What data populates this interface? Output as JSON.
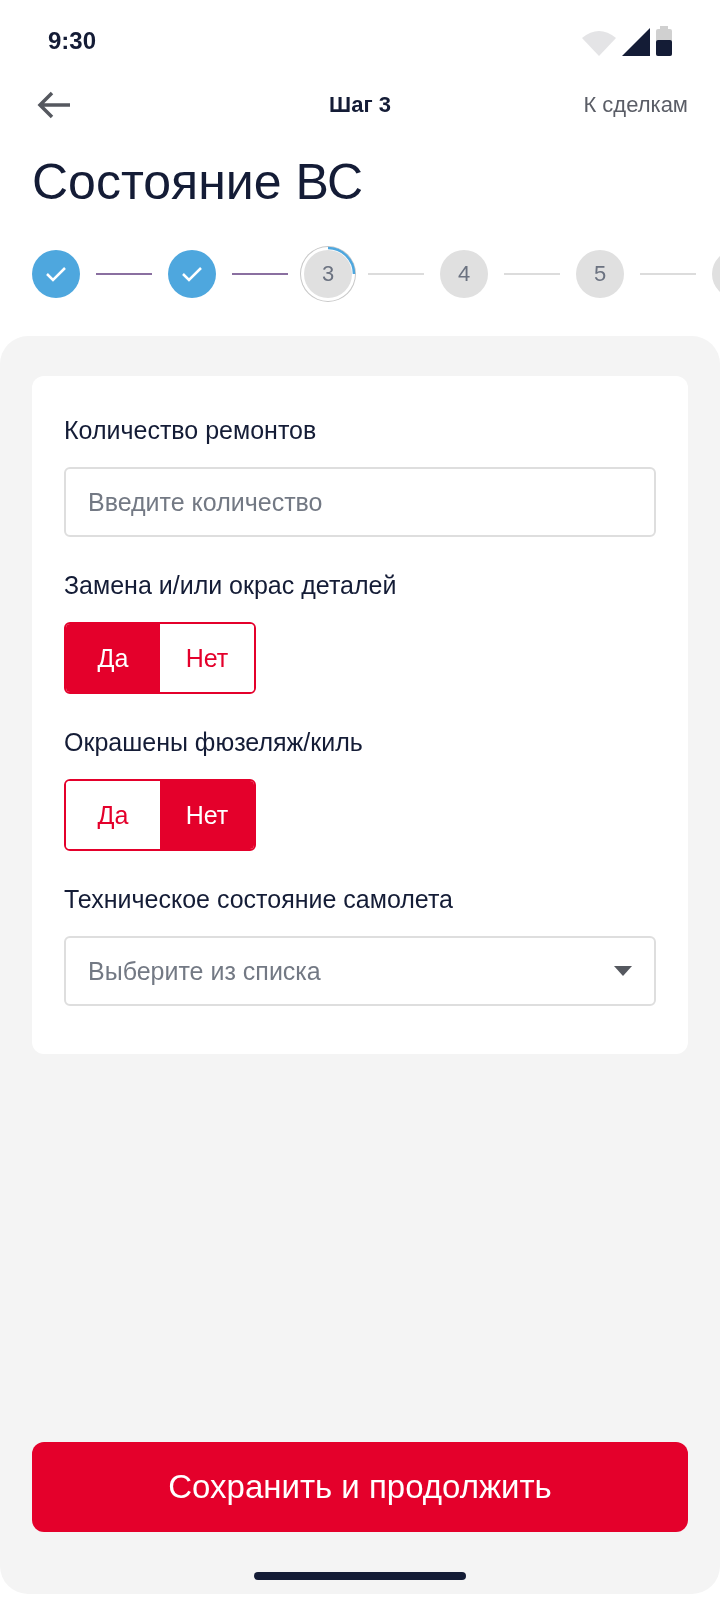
{
  "status_bar": {
    "time": "9:30"
  },
  "header": {
    "title": "Шаг 3",
    "action": "К сделкам"
  },
  "page_title": "Состояние ВС",
  "steps": [
    {
      "kind": "done"
    },
    {
      "kind": "done"
    },
    {
      "kind": "current",
      "label": "3"
    },
    {
      "kind": "upcoming",
      "label": "4"
    },
    {
      "kind": "upcoming",
      "label": "5"
    },
    {
      "kind": "upcoming"
    }
  ],
  "fields": [
    {
      "kind": "input",
      "label": "Количество ремонтов",
      "placeholder": "Введите количество"
    },
    {
      "kind": "toggle",
      "label": "Замена и/или окрас деталей",
      "options": [
        {
          "label": "Да",
          "selected": true
        },
        {
          "label": "Нет",
          "selected": false
        }
      ]
    },
    {
      "kind": "toggle",
      "label": "Окрашены фюзеляж/киль",
      "options": [
        {
          "label": "Да",
          "selected": false
        },
        {
          "label": "Нет",
          "selected": true
        }
      ]
    },
    {
      "kind": "select",
      "label": "Техническое состояние самолета",
      "placeholder": "Выберите из списка"
    }
  ],
  "primary_button": "Сохранить и продолжить"
}
